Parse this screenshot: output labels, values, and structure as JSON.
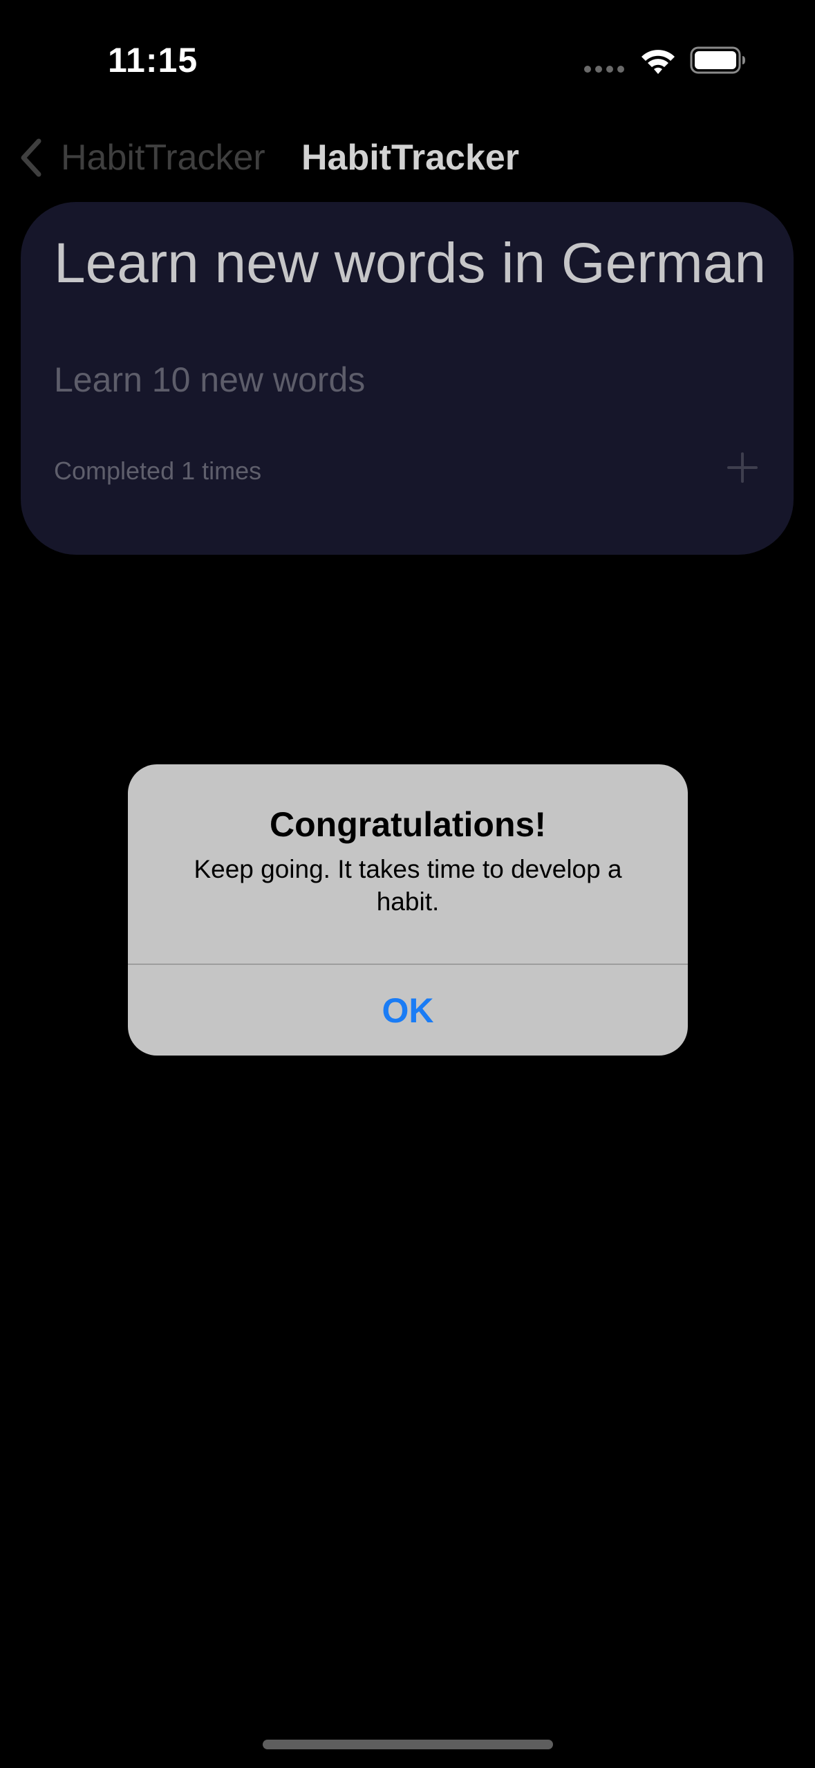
{
  "status_bar": {
    "time": "11:15",
    "icons": [
      "cellular-dots-icon",
      "wifi-icon",
      "battery-icon"
    ]
  },
  "nav": {
    "back_label": "HabitTracker",
    "back_icon": "chevron-left-icon",
    "title": "HabitTracker"
  },
  "habit": {
    "title": "Learn new words in German",
    "goal": "Learn 10 new words",
    "completed": "Completed 1 times",
    "add_icon": "plus-icon"
  },
  "alert": {
    "title": "Congratulations!",
    "message": "Keep going. It takes time to develop a habit.",
    "ok_label": "OK"
  },
  "colors": {
    "background": "#000000",
    "card": "#16162a",
    "alert_background": "#c5c5c5",
    "accent": "#1a7cf5"
  }
}
